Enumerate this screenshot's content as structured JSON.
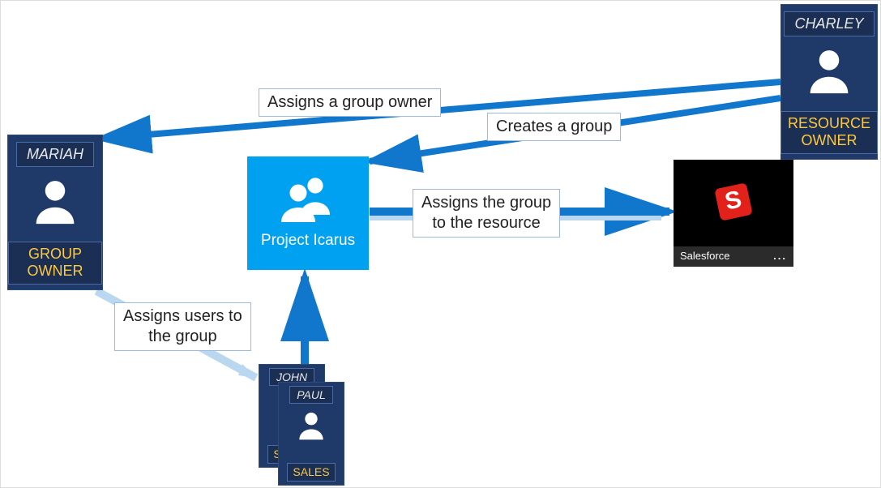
{
  "actors": {
    "charley": {
      "name": "CHARLEY",
      "role": "RESOURCE OWNER"
    },
    "mariah": {
      "name": "MARIAH",
      "role": "GROUP OWNER"
    },
    "john": {
      "name": "JOHN",
      "role": "SALES"
    },
    "paul": {
      "name": "PAUL",
      "role": "SALES"
    }
  },
  "group": {
    "name": "Project Icarus"
  },
  "resource": {
    "name": "Salesforce",
    "more": "..."
  },
  "edges": {
    "assigns_owner": "Assigns a group owner",
    "creates_group": "Creates a group",
    "assigns_resource_l1": "Assigns the group",
    "assigns_resource_l2": "to the resource",
    "assigns_users_l1": "Assigns users to",
    "assigns_users_l2": "the group"
  },
  "colors": {
    "card_bg": "#1f3a68",
    "card_border": "#4a6ba5",
    "role_text": "#ffc83d",
    "tile_bg": "#00a1f1",
    "arrow": "#1177cc",
    "arrow_light": "#b9d8ef"
  }
}
